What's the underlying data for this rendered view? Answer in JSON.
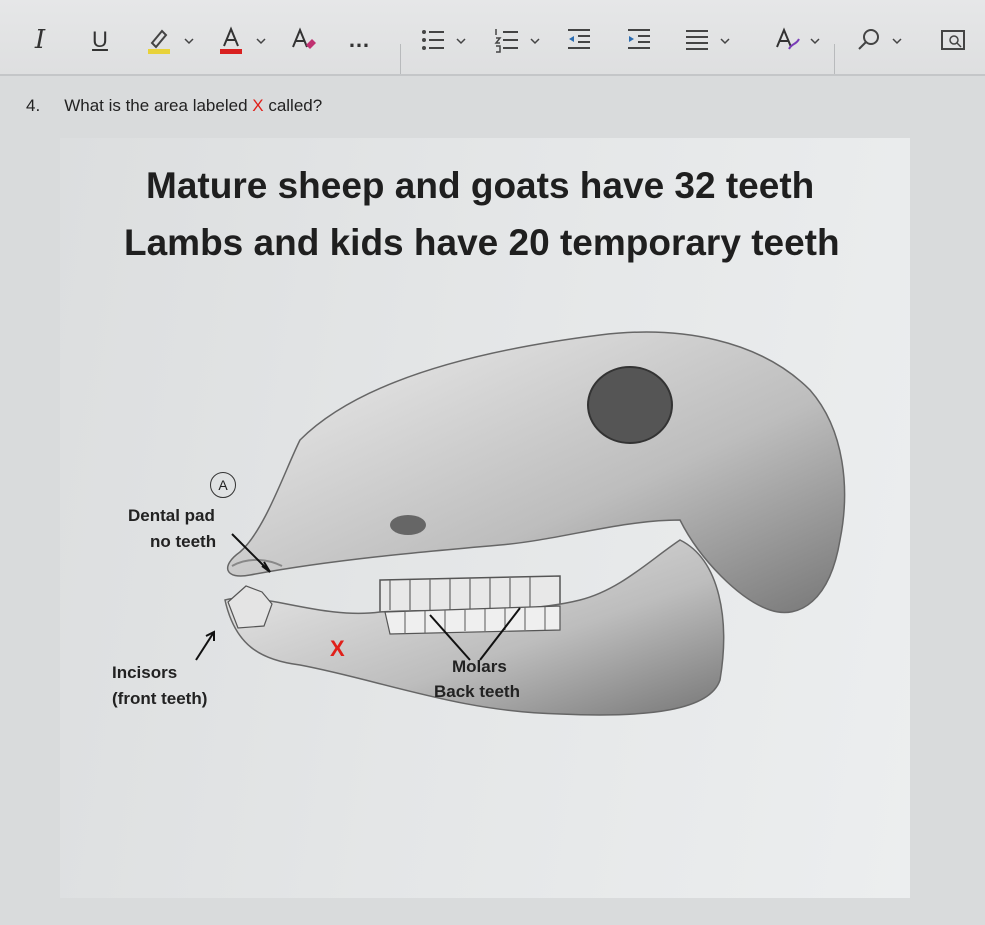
{
  "toolbar": {
    "italic": "I",
    "underline": "U",
    "more": "…",
    "buttons": [
      "italic-button",
      "underline-button",
      "highlight-button",
      "font-color-button",
      "clear-format-button",
      "more-button",
      "bullets-button",
      "numbering-button",
      "decrease-indent-button",
      "increase-indent-button",
      "align-button",
      "styles-button",
      "find-button",
      "immersive-reader-button"
    ],
    "colors": {
      "highlight": "#e8d23a",
      "font_color": "#d92020"
    }
  },
  "question": {
    "number": "4.",
    "text_before": "What is the area labeled ",
    "x": "X",
    "text_after": " called?"
  },
  "slide": {
    "title_line1": "Mature sheep and goats have 32 teeth",
    "title_line2": "Lambs and kids have 20 temporary teeth",
    "label_a": "A",
    "dental_pad_1": "Dental pad",
    "dental_pad_2": "no teeth",
    "incisors_1": "Incisors",
    "incisors_2": "(front teeth)",
    "molars_1": "Molars",
    "molars_2": "Back teeth",
    "x_mark": "X"
  }
}
